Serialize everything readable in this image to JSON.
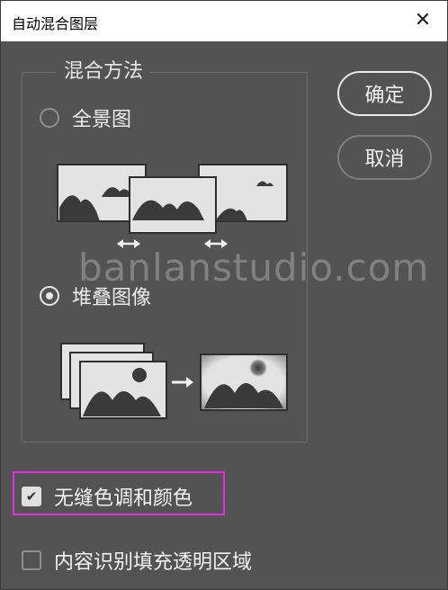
{
  "dialog": {
    "title": "自动混合图层",
    "close_glyph": "✕"
  },
  "blend_method": {
    "legend": "混合方法",
    "options": [
      {
        "label": "全景图",
        "selected": false
      },
      {
        "label": "堆叠图像",
        "selected": true
      }
    ]
  },
  "buttons": {
    "ok": "确定",
    "cancel": "取消"
  },
  "watermark": "banlanstudio.com",
  "checkboxes": [
    {
      "label": "无缝色调和颜色",
      "checked": true,
      "check_glyph": "✔"
    },
    {
      "label": "内容识别填充透明区域",
      "checked": false
    }
  ],
  "colors": {
    "dialog_bg": "#535353",
    "highlight": "#e32ce3",
    "illustration_fill": "#e3e3e3",
    "illustration_shape": "#3a3a3a"
  }
}
